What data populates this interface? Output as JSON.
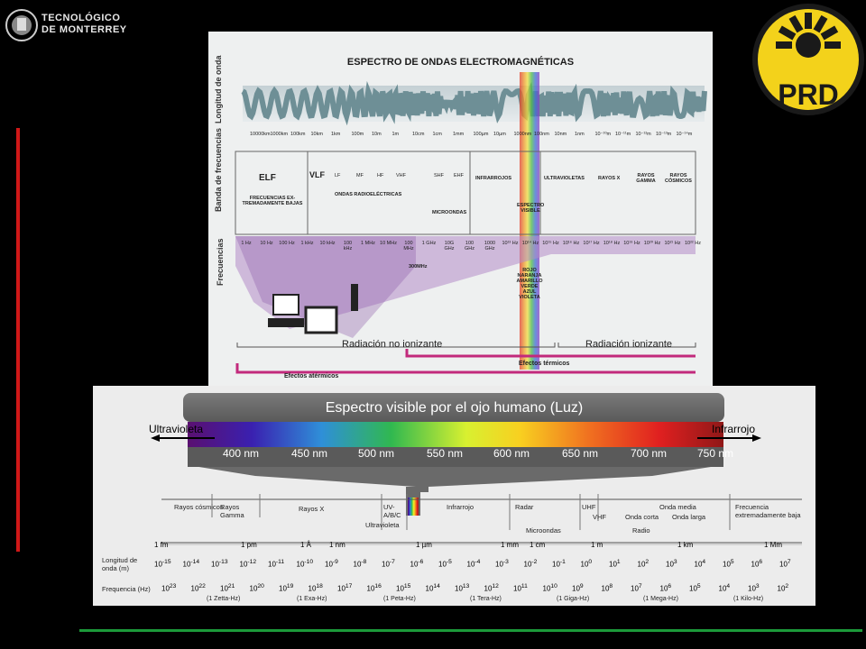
{
  "header": {
    "logo_line1": "TECNOLÓGICO",
    "logo_line2": "DE MONTERREY",
    "prd_text": "PRD"
  },
  "top_diagram": {
    "title": "ESPECTRO DE ONDAS ELECTROMAGNÉTICAS",
    "row_labels": [
      "Longitud de onda",
      "Banda de frecuencias",
      "Frecuencias"
    ],
    "wavelengths": [
      "10000km",
      "1000km",
      "100km",
      "10km",
      "1km",
      "100m",
      "10m",
      "1m",
      "10cm",
      "1cm",
      "1mm",
      "100µm",
      "10µm",
      "1000nm",
      "100nm",
      "10nm",
      "1nm",
      "10⁻¹⁰m",
      "10⁻¹¹m",
      "10⁻¹²m",
      "10⁻¹³m",
      "10⁻¹⁴m"
    ],
    "bands": [
      "ELF",
      "VLF",
      "LF",
      "MF",
      "HF",
      "VHF",
      "SHF",
      "EHF",
      "INFRARROJOS",
      "ULTRAVIOLETAS",
      "RAYOS X",
      "RAYOS GAMMA",
      "RAYOS CÓSMICOS"
    ],
    "band_desc": [
      "FRECUENCIAS EX-TREMADAMENTE BAJAS",
      "ONDAS RADIOELÉCTRICAS",
      "MICROONDAS",
      "ESPECTRO VISIBLE"
    ],
    "frequencies": [
      "1 Hz",
      "10 Hz",
      "100 Hz",
      "1 kHz",
      "10 kHz",
      "100 kHz",
      "1 MHz",
      "10 MHz",
      "100 MHz",
      "1 GHz",
      "10G GHz",
      "100 GHz",
      "1000 GHz",
      "10¹³ Hz",
      "10¹⁴ Hz",
      "10¹⁵ Hz",
      "10¹⁶ Hz",
      "10¹⁷ Hz",
      "10¹⁸ Hz",
      "10¹⁹ Hz",
      "10²⁰ Hz",
      "10²¹ Hz",
      "10²² Hz"
    ],
    "freq_300": "300MHz",
    "colors": [
      "ROJO",
      "NARANJA",
      "AMARILLO",
      "VERDE",
      "AZUL",
      "VIOLETA"
    ],
    "radiation_non_ion": "Radiación no ionizante",
    "radiation_ion": "Radiación ionizante",
    "thermal": "Efectos térmicos",
    "athermal": "Efectos atérmicos"
  },
  "visible_chart": {
    "title": "Espectro visible por el ojo humano (Luz)",
    "left_label": "Ultravioleta",
    "right_label": "Infrarrojo",
    "nm_ticks": [
      "400 nm",
      "450 nm",
      "500 nm",
      "550 nm",
      "600 nm",
      "650 nm",
      "700 nm",
      "750 nm"
    ],
    "bands": [
      "Rayos cósmicos",
      "Rayos Gamma",
      "Rayos X",
      "UV-A/B/C",
      "Ultravioleta",
      "Infrarrojo",
      "Radar",
      "Microondas",
      "UHF",
      "VHF",
      "Onda corta",
      "Onda media",
      "Onda larga",
      "Radio",
      "Frecuencia extremadamente baja"
    ],
    "wave_units": [
      "1 fm",
      "1 pm",
      "1 Å",
      "1 nm",
      "1 µm",
      "1 mm",
      "1 cm",
      "1 m",
      "1 km",
      "1 Mm"
    ],
    "wave_label": "Longitud de onda (m)",
    "wave_exp": [
      "-15",
      "-14",
      "-13",
      "-12",
      "-11",
      "-10",
      "-9",
      "-8",
      "-7",
      "-6",
      "-5",
      "-4",
      "-3",
      "-2",
      "-1",
      "0",
      "1",
      "2",
      "3",
      "4",
      "5",
      "6",
      "7"
    ],
    "freq_label": "Frequencia (Hz)",
    "freq_exp": [
      "23",
      "22",
      "21",
      "20",
      "19",
      "18",
      "17",
      "16",
      "15",
      "14",
      "13",
      "12",
      "11",
      "10",
      "9",
      "8",
      "7",
      "6",
      "5",
      "4",
      "3",
      "2"
    ],
    "freq_units": [
      "(1 Zetta-Hz)",
      "(1 Exa-Hz)",
      "(1 Peta-Hz)",
      "(1 Tera-Hz)",
      "(1 Giga-Hz)",
      "(1 Mega-Hz)",
      "(1 Kilo-Hz)"
    ]
  }
}
